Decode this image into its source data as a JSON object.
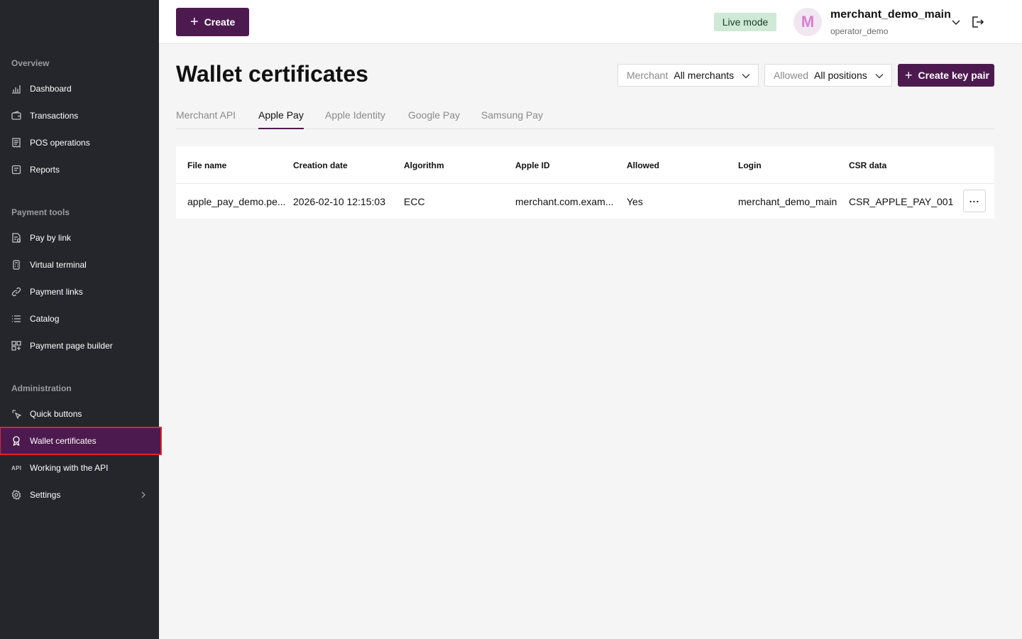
{
  "sidebar": {
    "sections": [
      {
        "label": "Overview"
      },
      {
        "label": "Payment tools"
      },
      {
        "label": "Administration"
      }
    ],
    "items": [
      {
        "label": "Dashboard",
        "icon": "chart-bars-icon"
      },
      {
        "label": "Transactions",
        "icon": "wallet-icon"
      },
      {
        "label": "POS operations",
        "icon": "receipt-icon"
      },
      {
        "label": "Reports",
        "icon": "document-icon"
      },
      {
        "label": "Pay by link",
        "icon": "invoice-icon"
      },
      {
        "label": "Virtual terminal",
        "icon": "terminal-icon"
      },
      {
        "label": "Payment links",
        "icon": "link-icon"
      },
      {
        "label": "Catalog",
        "icon": "list-icon"
      },
      {
        "label": "Payment page builder",
        "icon": "grid-plus-icon"
      },
      {
        "label": "Quick buttons",
        "icon": "click-icon"
      },
      {
        "label": "Wallet certificates",
        "icon": "award-icon"
      },
      {
        "label": "Working with the API",
        "icon": "api-icon",
        "icon_text": "API"
      },
      {
        "label": "Settings",
        "icon": "gear-icon"
      }
    ]
  },
  "topbar": {
    "create_label": "Create",
    "mode_badge": "Live mode",
    "avatar_letter": "M",
    "account_name": "merchant_demo_main",
    "account_user": "operator_demo"
  },
  "page": {
    "title": "Wallet certificates",
    "filters": {
      "merchant_label": "Merchant",
      "merchant_value": "All merchants",
      "allowed_label": "Allowed",
      "allowed_value": "All positions"
    },
    "create_key_pair_label": "Create key pair",
    "tabs": [
      "Merchant API",
      "Apple Pay",
      "Apple Identity",
      "Google Pay",
      "Samsung Pay"
    ],
    "active_tab": "Apple Pay"
  },
  "table": {
    "columns": [
      "File name",
      "Creation date",
      "Algorithm",
      "Apple ID",
      "Allowed",
      "Login",
      "CSR data"
    ],
    "rows": [
      [
        "apple_pay_demo.pe...",
        "2026-02-10 12:15:03",
        "ECC",
        "merchant.com.exam...",
        "Yes",
        "merchant_demo_main",
        "CSR_APPLE_PAY_001"
      ]
    ],
    "row_action": "..."
  },
  "colors": {
    "accent": "#4d1a4f",
    "sidebar_bg": "#24262b",
    "live_badge_bg": "#cfe9d7",
    "highlight_outline": "#e0242c"
  }
}
